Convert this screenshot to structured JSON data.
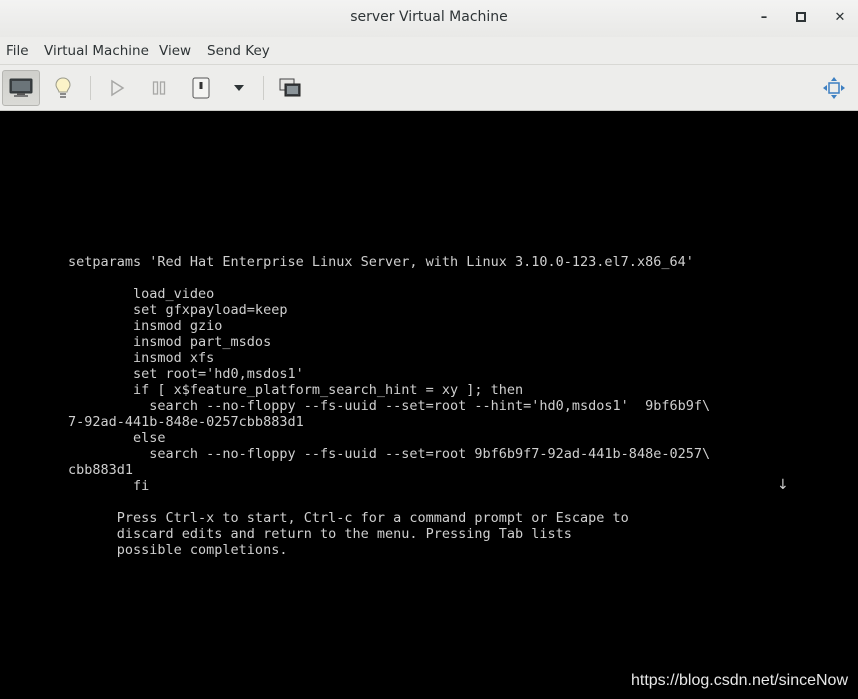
{
  "window": {
    "title": "server Virtual Machine",
    "minimize_glyph": "–",
    "maximize_glyph": "□",
    "close_glyph": "✕"
  },
  "menubar": {
    "items": [
      "File",
      "Virtual Machine",
      "View",
      "Send Key"
    ]
  },
  "toolbar": {
    "buttons": [
      {
        "name": "show-console-icon",
        "active": true
      },
      {
        "name": "show-details-icon",
        "active": false
      },
      {
        "name": "run-icon",
        "active": false,
        "disabled": true
      },
      {
        "name": "pause-icon",
        "active": false,
        "disabled": true
      },
      {
        "name": "shutdown-icon",
        "active": false
      },
      {
        "name": "shutdown-menu-arrow-icon",
        "active": false
      },
      {
        "name": "snapshots-icon",
        "active": false
      },
      {
        "name": "fullscreen-icon",
        "active": false
      }
    ]
  },
  "console": {
    "lines": [
      "setparams 'Red Hat Enterprise Linux Server, with Linux 3.10.0-123.el7.x86_64'",
      "",
      "        load_video",
      "        set gfxpayload=keep",
      "        insmod gzio",
      "        insmod part_msdos",
      "        insmod xfs",
      "        set root='hd0,msdos1'",
      "        if [ x$feature_platform_search_hint = xy ]; then",
      "          search --no-floppy --fs-uuid --set=root --hint='hd0,msdos1'  9bf6b9f\\",
      "7-92ad-441b-848e-0257cbb883d1",
      "        else",
      "          search --no-floppy --fs-uuid --set=root 9bf6b9f7-92ad-441b-848e-0257\\",
      "cbb883d1",
      "        fi",
      "",
      "      Press Ctrl-x to start, Ctrl-c for a command prompt or Escape to",
      "      discard edits and return to the menu. Pressing Tab lists",
      "      possible completions."
    ],
    "scroll_indicator": "↓"
  },
  "watermark": "https://blog.csdn.net/sinceNow"
}
